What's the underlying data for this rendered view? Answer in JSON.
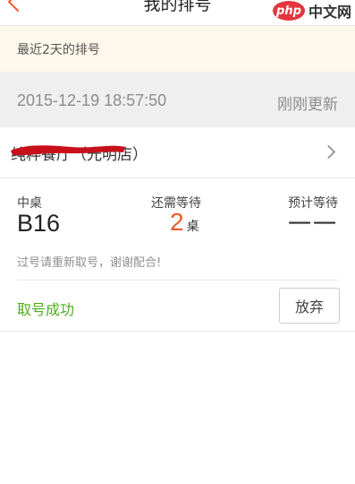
{
  "header": {
    "title": "我的排号",
    "back_icon": "chevron-left-icon",
    "back_color": "#f05a28"
  },
  "watermark": {
    "logo_text": "php",
    "site_text": "中文网"
  },
  "recent": {
    "label": "最近2天的排号"
  },
  "queue_record": {
    "datetime": "2015-12-19 18:57:50",
    "refresh_status": "刚刚更新",
    "restaurant_name": "纯粹餐厅（光明店）",
    "table_type_label": "中桌",
    "table_number": "B16",
    "wait_label": "还需等待",
    "wait_count": "2",
    "wait_unit": "桌",
    "estimate_label": "预计等待",
    "estimate_value": "一一",
    "notice": "过号请重新取号，谢谢配合!",
    "status": "取号成功",
    "give_up_label": "放弃"
  },
  "colors": {
    "accent": "#f05a28",
    "success": "#4caf1e",
    "redaction": "#c8101a"
  }
}
